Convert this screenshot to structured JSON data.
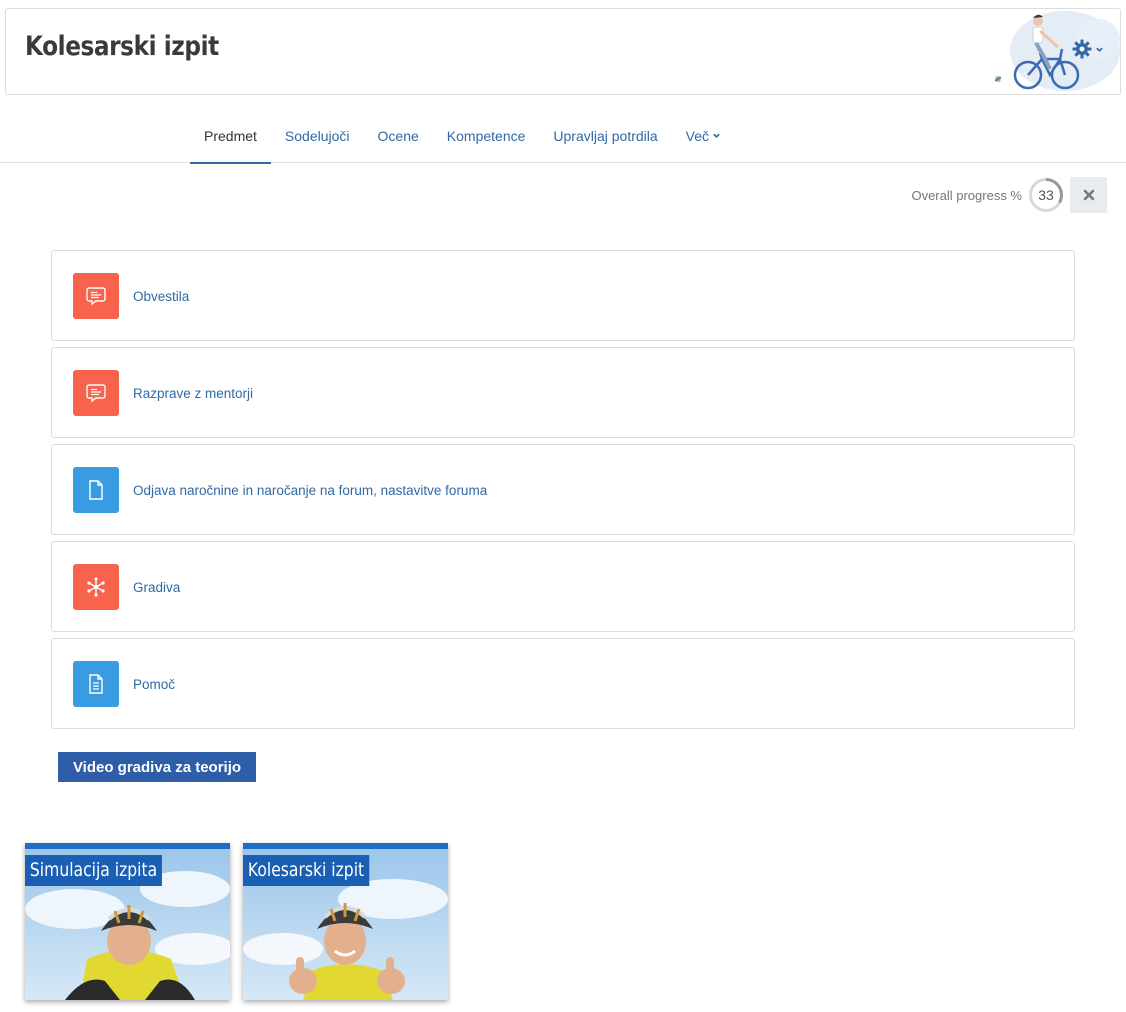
{
  "header": {
    "title": "Kolesarski izpit"
  },
  "nav": {
    "tabs": [
      {
        "label": "Predmet",
        "active": true
      },
      {
        "label": "Sodelujoči"
      },
      {
        "label": "Ocene"
      },
      {
        "label": "Kompetence"
      },
      {
        "label": "Upravljaj potrdila"
      },
      {
        "label": "Več"
      }
    ]
  },
  "progress": {
    "label": "Overall progress %",
    "value": "33",
    "fraction": 0.33
  },
  "activities": [
    {
      "label": "Obvestila",
      "icon": "forum-icon",
      "type": "forum"
    },
    {
      "label": "Razprave z mentorji",
      "icon": "forum-icon",
      "type": "forum"
    },
    {
      "label": "Odjava naročnine in naročanje na forum, nastavitve foruma",
      "icon": "file-icon",
      "type": "resource"
    },
    {
      "label": "Gradiva",
      "icon": "hub-icon",
      "type": "forum"
    },
    {
      "label": "Pomoč",
      "icon": "document-icon",
      "type": "resource"
    }
  ],
  "section": {
    "button_label": "Video gradiva za teorijo"
  },
  "videos": [
    {
      "label": "Simulacija izpita"
    },
    {
      "label": "Kolesarski izpit"
    }
  ],
  "colors": {
    "accent": "#2f6aa6",
    "forum": "#f7634d",
    "resource": "#399be2",
    "section_button": "#2f5ea8",
    "video_label": "#1a5fb4"
  }
}
